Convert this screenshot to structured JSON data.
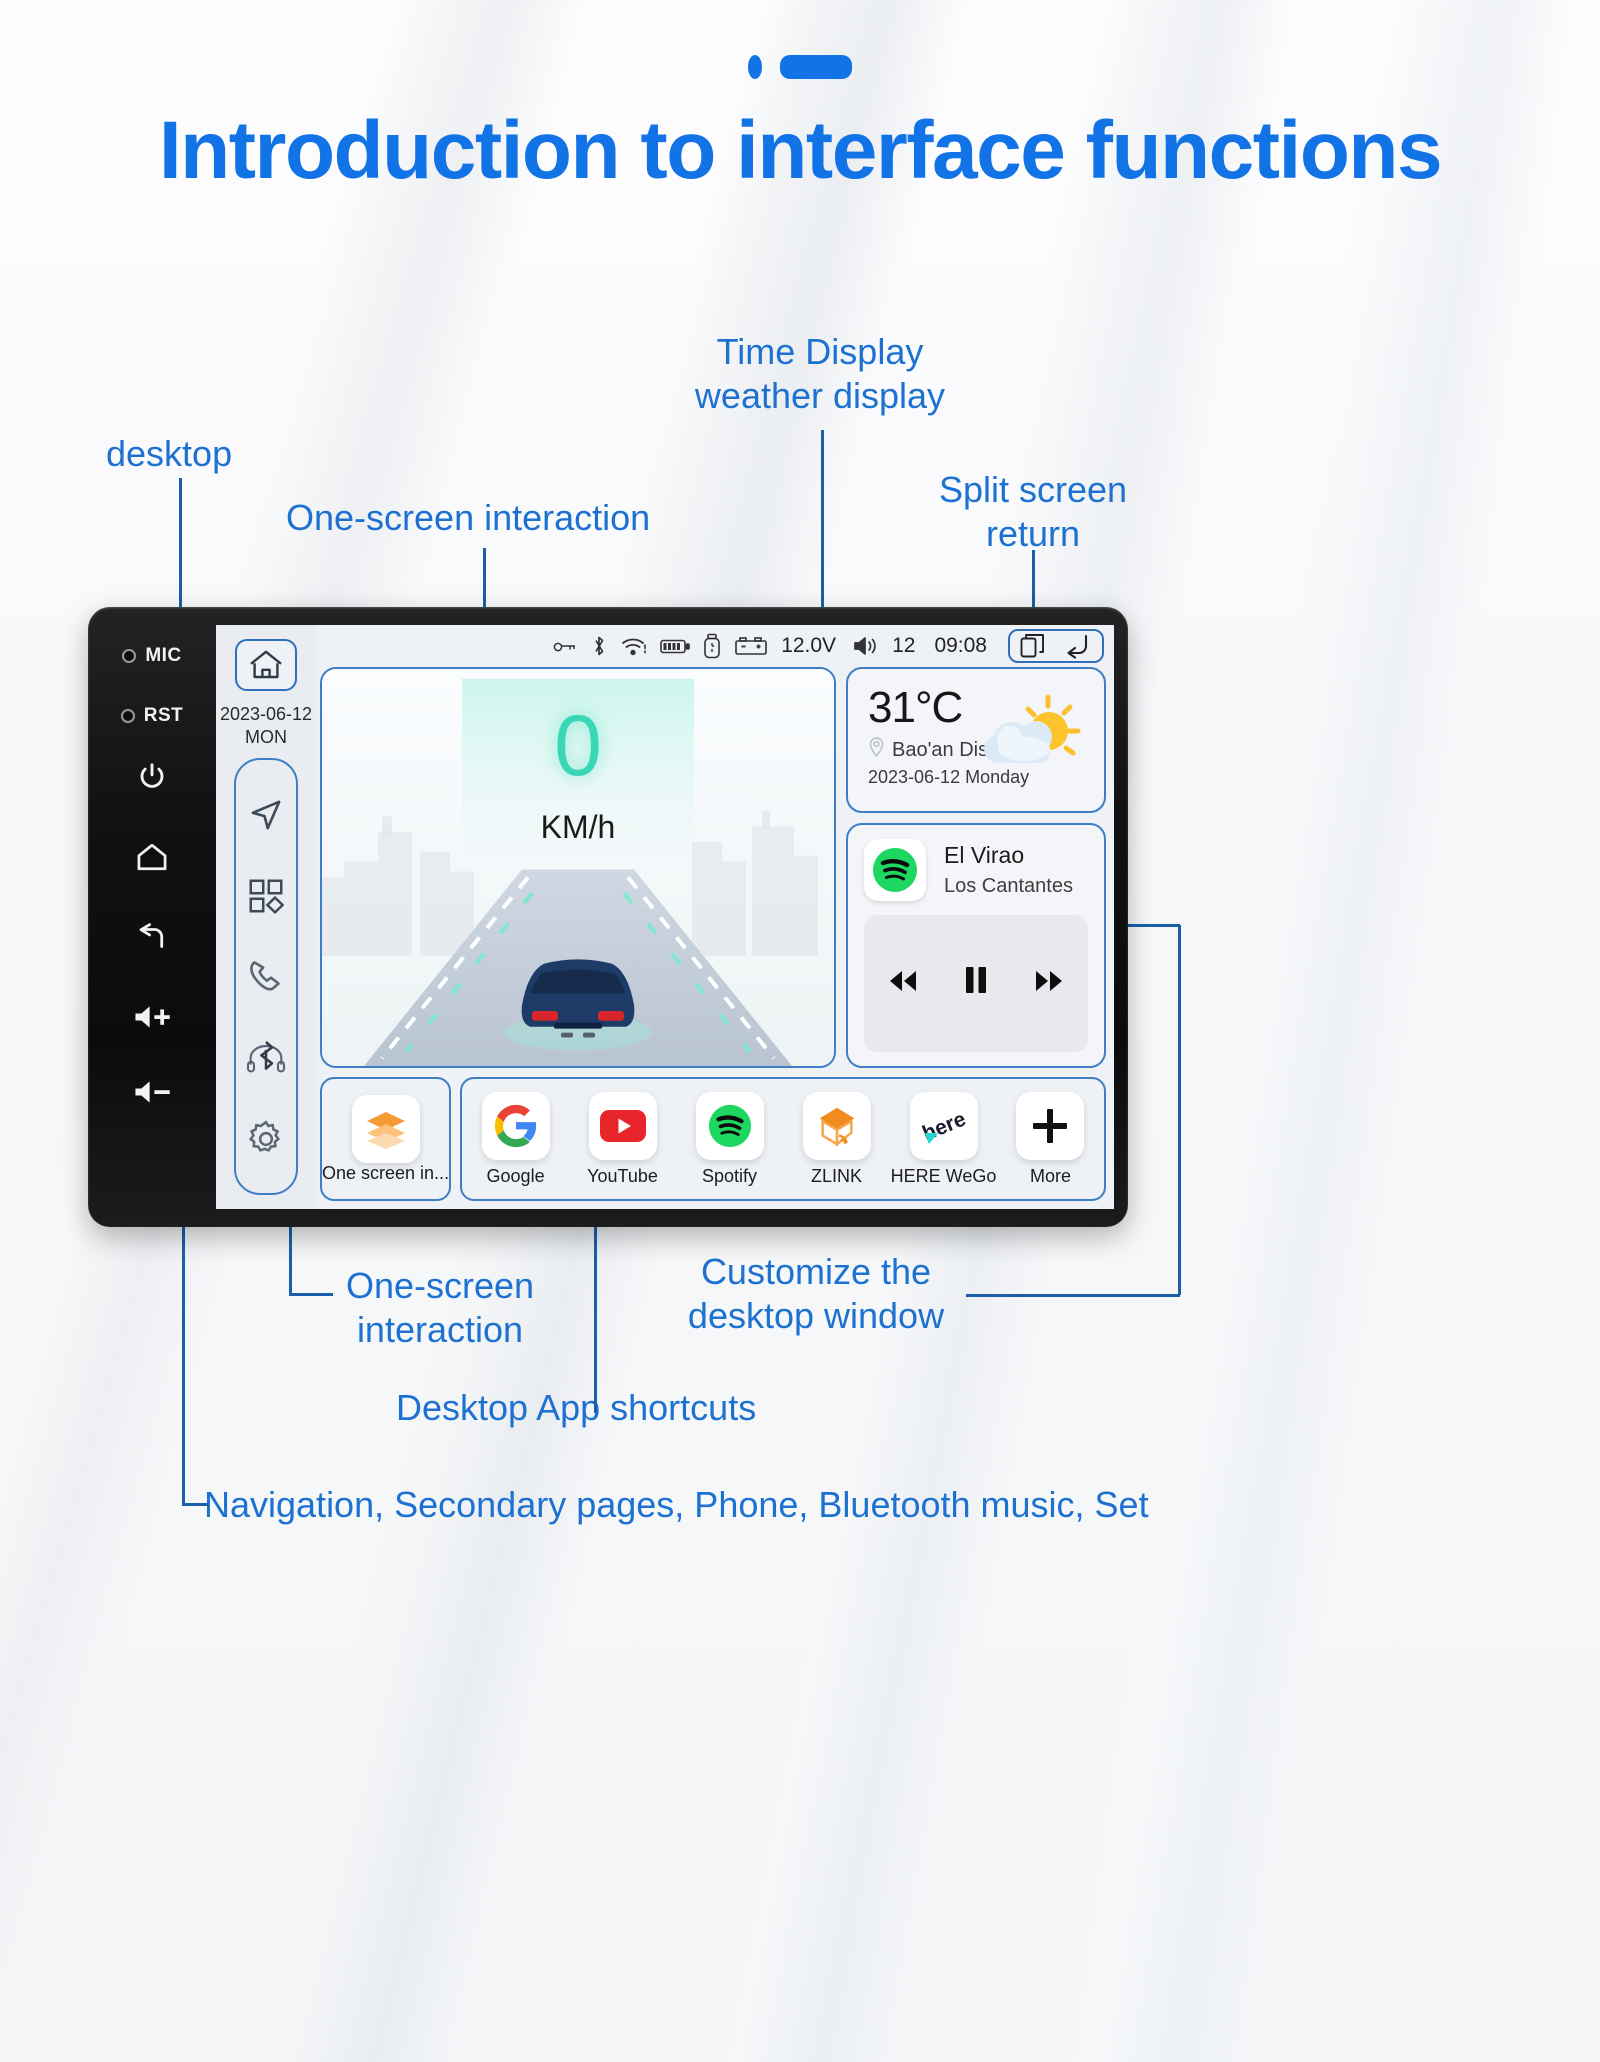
{
  "header": {
    "title": "Introduction to interface functions"
  },
  "annotations": {
    "desktop": "desktop",
    "one_screen_top": "One-screen interaction",
    "time_weather": "Time Display\nweather display",
    "split_screen": "Split screen\nreturn",
    "one_screen_bottom": "One-screen\ninteraction",
    "desktop_shortcuts": "Desktop App shortcuts",
    "customize_window": "Customize the\ndesktop window",
    "bottom_rail": "Navigation, Secondary pages, Phone, Bluetooth music, Set"
  },
  "device": {
    "hardware_buttons": [
      {
        "label": "MIC",
        "icon": "mic-hole-icon"
      },
      {
        "label": "RST",
        "icon": "reset-hole-icon"
      },
      {
        "label": "",
        "icon": "power-icon",
        "glyph": "⏻"
      },
      {
        "label": "",
        "icon": "home-icon",
        "glyph": "⌂"
      },
      {
        "label": "",
        "icon": "back-icon",
        "glyph": "↩"
      },
      {
        "label": "",
        "icon": "volume-up-icon",
        "glyph": "🔊+"
      },
      {
        "label": "",
        "icon": "volume-down-icon",
        "glyph": "🔊−"
      }
    ]
  },
  "screen": {
    "rail": {
      "home_button": "home-outline-icon",
      "date": "2023-06-12",
      "weekday": "MON",
      "icons": [
        {
          "name": "navigation-arrow-icon"
        },
        {
          "name": "apps-grid-icon"
        },
        {
          "name": "phone-icon"
        },
        {
          "name": "bluetooth-headset-icon"
        },
        {
          "name": "settings-gear-icon"
        }
      ]
    },
    "statusbar": {
      "icons": [
        "key-icon",
        "bluetooth-icon",
        "wifi-icon",
        "battery-icon",
        "usb-icon",
        "car-battery-icon"
      ],
      "voltage": "12.0V",
      "volume_icon": "volume-icon",
      "volume_value": "12",
      "time": "09:08",
      "split_screen_icon": "split-screen-icon",
      "return_icon": "return-arrow-icon"
    },
    "nav_panel": {
      "speed": "0",
      "unit": "KM/h"
    },
    "weather": {
      "temperature": "31°C",
      "location": "Bao'an District",
      "date": "2023-06-12 Monday",
      "condition_icon": "partly-cloudy-icon"
    },
    "music": {
      "app_icon": "spotify-icon",
      "title": "El Virao",
      "artist": "Los Cantantes",
      "controls": {
        "previous": "◀◀",
        "pause": "▐▐",
        "next": "▶▶"
      }
    },
    "dock": {
      "pinned": {
        "label": "One screen in...",
        "icon": "layers-icon"
      },
      "apps": [
        {
          "label": "Google",
          "icon": "google-icon"
        },
        {
          "label": "YouTube",
          "icon": "youtube-icon"
        },
        {
          "label": "Spotify",
          "icon": "spotify-icon"
        },
        {
          "label": "ZLINK",
          "icon": "zlink-icon"
        },
        {
          "label": "HERE WeGo",
          "icon": "here-wego-icon"
        },
        {
          "label": "More",
          "icon": "plus-icon"
        }
      ]
    }
  },
  "colors": {
    "accent": "#1273e6",
    "annotation": "#1d71d1",
    "card_border": "#3f7ec4",
    "speed": "#3ad7b6"
  }
}
